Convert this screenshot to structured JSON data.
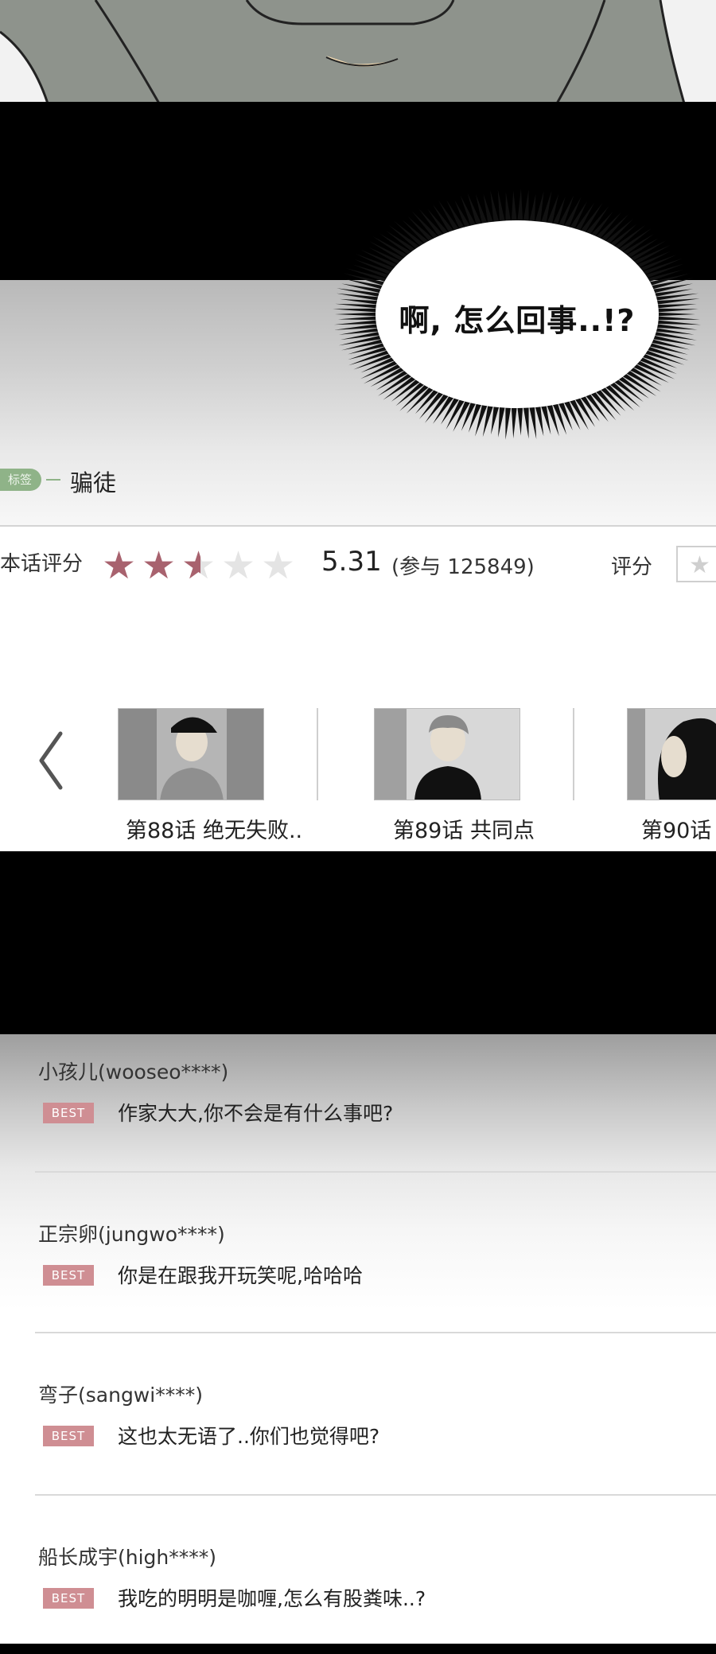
{
  "speech_bubble": {
    "text": "啊, 怎么回事..!?"
  },
  "tag": {
    "label": "标签",
    "value": "骗徒"
  },
  "rating": {
    "label": "本话评分",
    "stars_filled": 2.5,
    "stars_total": 5,
    "score": "5.31",
    "participants": "(参与 125849)",
    "rate_label": "评分",
    "star_color": "#a8626e"
  },
  "episodes": [
    {
      "title": "第88话 绝无失败.."
    },
    {
      "title": "第89话 共同点"
    },
    {
      "title": "第90话"
    }
  ],
  "comments": [
    {
      "user": "小孩儿(wooseo****)",
      "badge": "BEST",
      "text": "作家大大,你不会是有什么事吧?"
    },
    {
      "user": "正宗卵(jungwo****)",
      "badge": "BEST",
      "text": "你是在跟我开玩笑呢,哈哈哈"
    },
    {
      "user": "弯子(sangwi****)",
      "badge": "BEST",
      "text": "这也太无语了..你们也觉得吧?"
    },
    {
      "user": "船长成宇(high****)",
      "badge": "BEST",
      "text": "我吃的明明是咖喱,怎么有股粪味..?"
    }
  ],
  "colors": {
    "badge": "#cf8e93",
    "tag": "#8fb388"
  }
}
